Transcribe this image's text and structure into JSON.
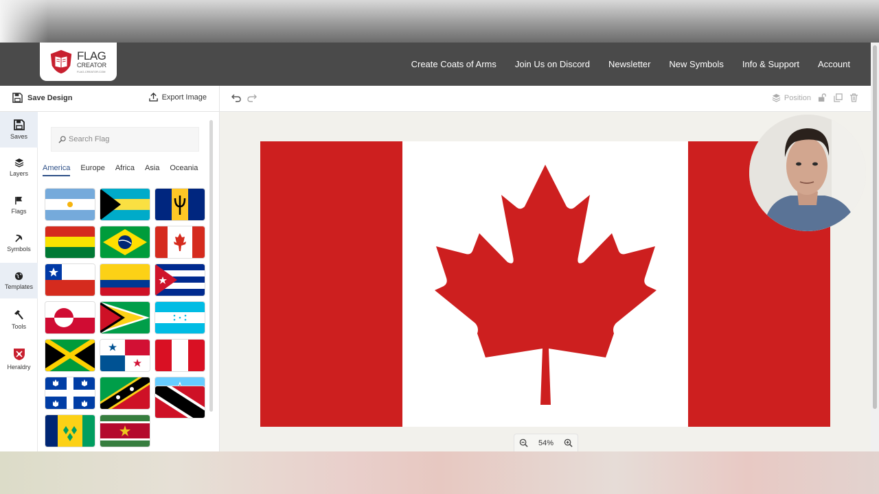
{
  "brand": {
    "line1": "FLAG",
    "line2": "CREATOR",
    "line3": "FLAG-CREATOR.COM"
  },
  "nav": [
    {
      "label": "Create Coats of Arms"
    },
    {
      "label": "Join Us on Discord"
    },
    {
      "label": "Newsletter"
    },
    {
      "label": "New Symbols"
    },
    {
      "label": "Info & Support"
    },
    {
      "label": "Account"
    }
  ],
  "toolbar": {
    "save_label": "Save Design",
    "export_label": "Export Image",
    "position_label": "Position"
  },
  "sidebar": {
    "items": [
      {
        "label": "Saves",
        "icon": "floppy-icon"
      },
      {
        "label": "Layers",
        "icon": "layers-icon"
      },
      {
        "label": "Flags",
        "icon": "flag-icon"
      },
      {
        "label": "Symbols",
        "icon": "hammer-sickle-icon"
      },
      {
        "label": "Templates",
        "icon": "globe-icon"
      },
      {
        "label": "Tools",
        "icon": "hammer-icon"
      },
      {
        "label": "Heraldry",
        "icon": "shield-icon"
      }
    ]
  },
  "search": {
    "placeholder": "Search Flag"
  },
  "regions": [
    {
      "label": "America",
      "active": true
    },
    {
      "label": "Europe"
    },
    {
      "label": "Africa"
    },
    {
      "label": "Asia"
    },
    {
      "label": "Oceania"
    }
  ],
  "flags": [
    "argentina",
    "bahamas",
    "barbados",
    "bolivia",
    "brazil",
    "canada",
    "chile",
    "colombia",
    "cuba",
    "greenland",
    "guyana",
    "honduras",
    "jamaica",
    "panama",
    "peru",
    "quebec",
    "saint-kitts-and-nevis",
    "saint-lucia",
    "saint-vincent",
    "suriname",
    "trinidad-and-tobago"
  ],
  "canvas": {
    "current_flag": "canada",
    "zoom": "54%"
  },
  "colors": {
    "nav_bg": "#4a4a4a",
    "accent": "#2c4e86",
    "canada_red": "#cd1f1f"
  }
}
